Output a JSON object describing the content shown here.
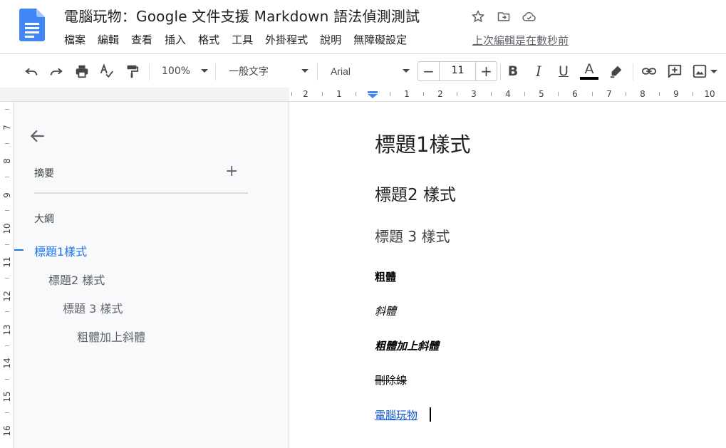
{
  "document": {
    "title": "電腦玩物：Google 文件支援 Markdown 語法偵測測試",
    "last_edit": "上次編輯是在數秒前"
  },
  "title_icons": [
    "star-icon",
    "move-to-folder-icon",
    "cloud-saved-icon"
  ],
  "menu": [
    "檔案",
    "編輯",
    "查看",
    "插入",
    "格式",
    "工具",
    "外掛程式",
    "說明",
    "無障礙設定"
  ],
  "toolbar": {
    "zoom": "100%",
    "style": "一般文字",
    "font": "Arial",
    "font_size": "11",
    "minus": "−",
    "plus": "+",
    "bold": "B",
    "italic": "I",
    "underline": "U",
    "text_color": "A",
    "text_color_hex": "#000000"
  },
  "ruler": {
    "h_labels": [
      "2",
      "1",
      "1",
      "2",
      "3",
      "4",
      "5",
      "6",
      "7",
      "8",
      "9",
      "10"
    ],
    "v_labels": [
      "7",
      "8",
      "9",
      "10",
      "11",
      "12",
      "13",
      "14",
      "15",
      "16"
    ]
  },
  "outline_panel": {
    "summary_label": "摘要",
    "add": "+",
    "outline_label": "大綱",
    "items": [
      {
        "text": "標題1樣式",
        "level": 1,
        "active": true
      },
      {
        "text": "標題2 樣式",
        "level": 2,
        "active": false
      },
      {
        "text": "標題 3 樣式",
        "level": 3,
        "active": false
      },
      {
        "text": "粗體加上斜體",
        "level": 4,
        "active": false
      }
    ]
  },
  "body": {
    "h1": "標題1樣式",
    "h2": "標題2 樣式",
    "h3": "標題 3 樣式",
    "bold": "粗體",
    "italic": "斜體",
    "bold_italic": "粗體加上斜體",
    "strikethrough": "刪除線",
    "link": "電腦玩物"
  },
  "colors": {
    "accent": "#1a73e8",
    "link": "#1155cc",
    "docs_blue": "#4285f4"
  }
}
